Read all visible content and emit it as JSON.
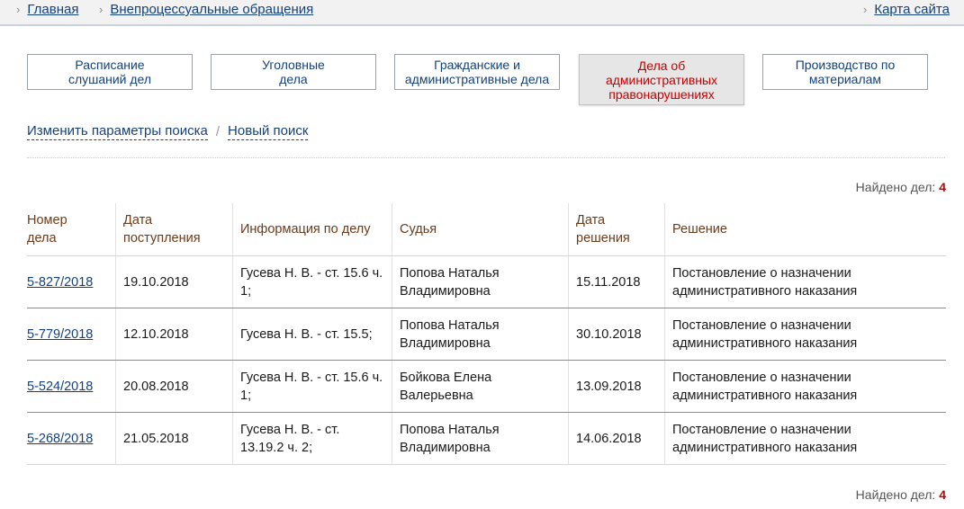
{
  "breadcrumb": {
    "home": "Главная",
    "section": "Внепроцессуальные обращения",
    "sitemap": "Карта сайта"
  },
  "categories": [
    {
      "label": "Расписание\nслушаний дел",
      "active": false
    },
    {
      "label": "Уголовные\nдела",
      "active": false
    },
    {
      "label": "Гражданские и\nадминистративные дела",
      "active": false
    },
    {
      "label": "Дела об\nадминистративных\nправонарушениях",
      "active": true
    },
    {
      "label": "Производство по\nматериалам",
      "active": false
    }
  ],
  "search": {
    "change_params": "Изменить параметры поиска",
    "separator": "/",
    "new_search": "Новый поиск"
  },
  "found": {
    "label": "Найдено дел:",
    "count": "4"
  },
  "table": {
    "headers": [
      "Номер\nдела",
      "Дата\nпоступления",
      "Информация по делу",
      "Судья",
      "Дата\nрешения",
      "Решение"
    ],
    "rows": [
      {
        "case": "5-827/2018",
        "received": "19.10.2018",
        "info": "Гусева Н. В. - ст. 15.6 ч. 1;",
        "judge": "Попова Наталья Владимировна",
        "decided": "15.11.2018",
        "decision": "Постановление о назначении административного наказания"
      },
      {
        "case": "5-779/2018",
        "received": "12.10.2018",
        "info": "Гусева Н. В. - ст. 15.5;",
        "judge": "Попова Наталья Владимировна",
        "decided": "30.10.2018",
        "decision": "Постановление о назначении административного наказания"
      },
      {
        "case": "5-524/2018",
        "received": "20.08.2018",
        "info": "Гусева Н. В. - ст. 15.6 ч. 1;",
        "judge": "Бойкова Елена Валерьевна",
        "decided": "13.09.2018",
        "decision": "Постановление о назначении административного наказания"
      },
      {
        "case": "5-268/2018",
        "received": "21.05.2018",
        "info": "Гусева Н. В. - ст. 13.19.2 ч. 2;",
        "judge": "Попова Наталья Владимировна",
        "decided": "14.06.2018",
        "decision": "Постановление о назначении административного наказания"
      }
    ]
  },
  "colors": {
    "link": "#14417a",
    "active_category": "#c40000",
    "header_text": "#6b3b1a",
    "count": "#a01010"
  }
}
